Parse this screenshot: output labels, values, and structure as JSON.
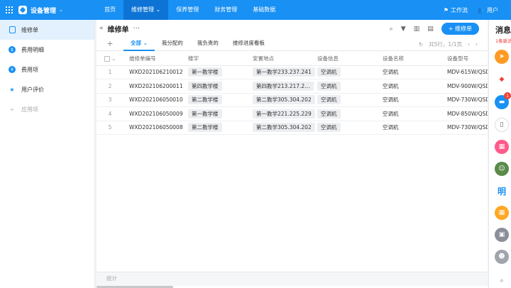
{
  "topbar": {
    "app_title": "设备管理",
    "nav": [
      "首页",
      "维修管理",
      "保养管理",
      "财务管理",
      "基础数据"
    ],
    "workflow_label": "工作流",
    "user_label": "用户"
  },
  "sidebar": {
    "items": [
      {
        "label": "维修单",
        "icon": "document-icon"
      },
      {
        "label": "费用明细",
        "icon": "dollar-icon"
      },
      {
        "label": "费用项",
        "icon": "coin-icon"
      },
      {
        "label": "用户评价",
        "icon": "star-icon"
      },
      {
        "label": "应用项",
        "icon": "plus-icon"
      }
    ]
  },
  "main": {
    "title": "维修单",
    "more": "···",
    "new_button": "+ 维修单",
    "tabs": [
      "全部",
      "我分配的",
      "我负责的",
      "维修进度看板"
    ],
    "pager": "共5行，1/1页"
  },
  "table": {
    "headers": [
      "维修单编号",
      "楼宇",
      "安置地点",
      "设备信息",
      "设备名称",
      "设备型号"
    ],
    "rows": [
      {
        "index": "1",
        "id": "WXD202106210012",
        "building": "第一教学楼",
        "location": "第一教学233.237.241",
        "info": "空调机",
        "name": "空调机",
        "model": "MDV-615W/QSD"
      },
      {
        "index": "2",
        "id": "WXD202106200011",
        "building": "第四教学楼",
        "location": "第四教学213.217.2…",
        "info": "空调机",
        "name": "空调机",
        "model": "MDV-900W/QSD"
      },
      {
        "index": "3",
        "id": "WXD202106050010",
        "building": "第二教学楼",
        "location": "第二教学305.304.202",
        "info": "空调机",
        "name": "空调机",
        "model": "MDV-730W/QSD"
      },
      {
        "index": "4",
        "id": "WXD202106050009",
        "building": "第一教学楼",
        "location": "第一教学221.225.229",
        "info": "空调机",
        "name": "空调机",
        "model": "MDV-850W/QSD"
      },
      {
        "index": "5",
        "id": "WXD202106050008",
        "building": "第二教学楼",
        "location": "第二教学305.304.202",
        "info": "空调机",
        "name": "空调机",
        "model": "MDV-730W/QSD"
      }
    ],
    "footer": "统计"
  },
  "right_panel": {
    "title": "消息",
    "subtitle": "1条新消息",
    "badge_count": "1",
    "ming": "明"
  },
  "colors": {
    "brand": "#1890f4",
    "active_nav": "#0d74d6",
    "badge": "#f04134"
  }
}
